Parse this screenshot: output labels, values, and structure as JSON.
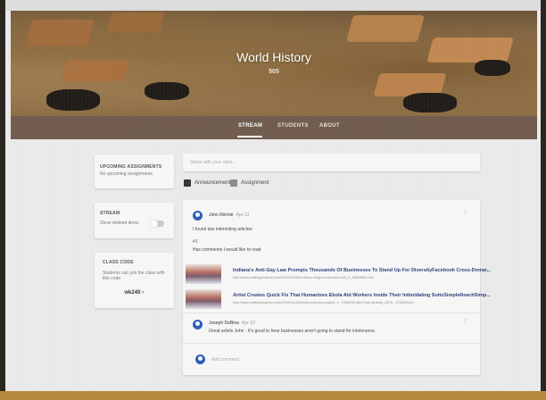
{
  "course": {
    "title": "World History",
    "section": "505"
  },
  "tabs": [
    {
      "label": "STREAM",
      "active": true
    },
    {
      "label": "STUDENTS",
      "active": false
    },
    {
      "label": "ABOUT",
      "active": false
    }
  ],
  "sidebar": {
    "upcoming": {
      "title": "UPCOMING ASSIGNMENTS",
      "text": "No upcoming assignments"
    },
    "stream": {
      "title": "STREAM",
      "text": "Show deleted items",
      "toggle_on": false
    },
    "class_code": {
      "title": "CLASS CODE",
      "text": "Students can join the class with this code",
      "code": "wk240"
    }
  },
  "composer": {
    "placeholder": "Share with your class...",
    "announcement_label": "Announcement",
    "assignment_label": "Assignment"
  },
  "post": {
    "author": "John Ritchie",
    "date": "Apr 13",
    "lines": [
      "I found two interesting articles:",
      "#1",
      "Has comments I would like to read"
    ],
    "links": [
      {
        "title": "Indiana's Anti-Gay Law Prompts Thousands Of Businesses To Stand Up For DiversityFacebook Cross-Domai...",
        "url": "http://www.huffingtonpost.com/2015/03/30/indiana-religious-freedom-bill_n_6969666.html"
      },
      {
        "title": "Artist Creates Quick Fix That Humanizes Ebola Aid Workers Inside Their Intimidating SuitsSimpleReachSimp...",
        "url": "http://www.huffingtonpost.com/2015/04/13/ebola-summer-project_n_7055236.html?cps=gravity_2676_-123683141..."
      }
    ]
  },
  "comment": {
    "author": "Joseph DeBina",
    "date": "Apr 13",
    "text": "Great article John - It's good to hear businesses aren't going to stand for intolerance."
  },
  "add_comment": {
    "placeholder": "Add comment..."
  },
  "icons": {
    "announcement": "announcement-icon",
    "assignment": "assignment-icon",
    "more": "more-vert-icon"
  },
  "colors": {
    "tabbar": "#6f5a4c",
    "avatar": "#2b5bb5",
    "announcement": "#333333",
    "assignment": "#8a8a8a"
  }
}
